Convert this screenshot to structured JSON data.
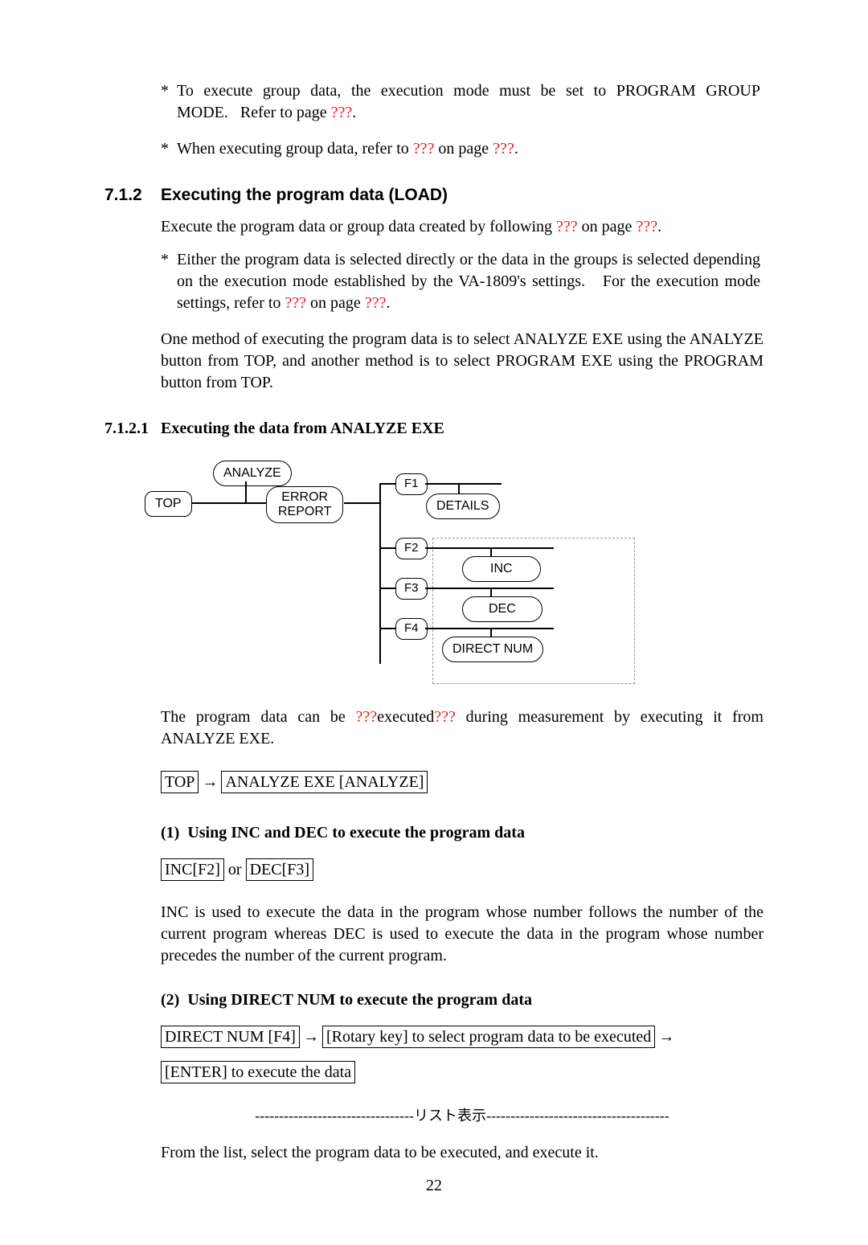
{
  "notes": {
    "n1a": "To execute group data, the execution mode must be set to PROGRAM GROUP MODE.   Refer to page ",
    "n1b": ".",
    "n2a": "When executing group data, refer to ",
    "n2b": " on page ",
    "n2c": "."
  },
  "ref": "???",
  "sec712": {
    "num": "7.1.2",
    "title": "Executing the program data (LOAD)",
    "p1a": "Execute the program data or group data created by following ",
    "p1b": " on page ",
    "p1c": ".",
    "b1a": "Either the program data is selected directly or the data in the groups is selected depending on the execution mode established by the VA-1809's settings.   For the execution mode settings, refer to ",
    "b1b": " on page ",
    "b1c": ".",
    "p2": "One method of executing the program data is to select ANALYZE EXE using the ANALYZE button from TOP, and another method is to select PROGRAM EXE using the PROGRAM button from TOP."
  },
  "sec7121": {
    "num": "7.1.2.1",
    "title": "Executing the data from ANALYZE EXE"
  },
  "diagram": {
    "top": "TOP",
    "analyze": "ANALYZE",
    "error": "ERROR\nREPORT",
    "f1": "F1",
    "f2": "F2",
    "f3": "F3",
    "f4": "F4",
    "details": "DETAILS",
    "inc": "INC",
    "dec": "DEC",
    "direct": "DIRECT NUM"
  },
  "para_exec_a": "The program data can be ",
  "para_exec_b": "executed",
  "para_exec_c": " during measurement by executing it from ANALYZE EXE.",
  "step1": {
    "a": "TOP",
    "b": "ANALYZE EXE [ANALYZE]"
  },
  "sub1": {
    "title": "(1)  Using INC and DEC to execute the program data",
    "inc": "INC[F2]",
    "dec": "DEC[F3]",
    "or": " or ",
    "para": "INC is used to execute the data in the program whose number follows the number of the current program whereas DEC is used to execute the data in the program whose number precedes the number of the current program."
  },
  "sub2": {
    "title": "(2)  Using DIRECT NUM to execute the program data",
    "a": "DIRECT NUM [F4]",
    "b": "[Rotary key] to select program data to be executed",
    "c": "[ENTER] to execute the data"
  },
  "divider": "---------------------------------リスト表示--------------------------------------",
  "lastpara": "From the list, select the program data to be executed, and execute it.",
  "pagenum": "22"
}
